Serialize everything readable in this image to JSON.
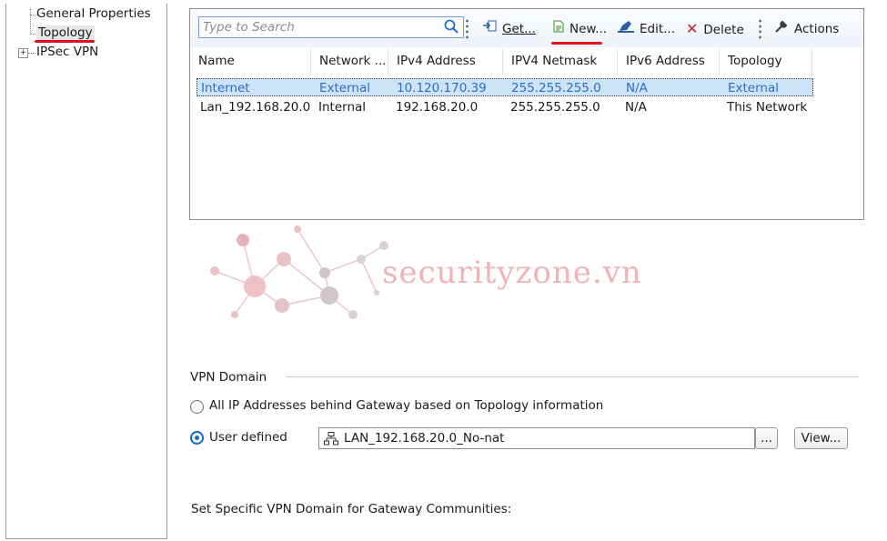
{
  "tree": {
    "items": [
      {
        "label": "General Properties"
      },
      {
        "label": "Topology"
      },
      {
        "label": "IPSec VPN"
      }
    ]
  },
  "toolbar": {
    "search_placeholder": "Type to Search",
    "get_label": "Get...",
    "new_label": "New...",
    "edit_label": "Edit...",
    "delete_label": "Delete",
    "actions_label": "Actions"
  },
  "table": {
    "columns": [
      "Name",
      "Network ...",
      "IPv4 Address",
      "IPV4 Netmask",
      "IPv6 Address",
      "Topology"
    ],
    "rows": [
      [
        "Internet",
        "External",
        "10.120.170.39",
        "255.255.255.0",
        "N/A",
        "External"
      ],
      [
        "Lan_192.168.20.0",
        "Internal",
        "192.168.20.0",
        "255.255.255.0",
        "N/A",
        "This Network"
      ]
    ]
  },
  "watermark": {
    "text": "securityzone.vn"
  },
  "vpn_domain": {
    "group_title": "VPN Domain",
    "option_all": "All IP Addresses behind Gateway based on Topology information",
    "option_user": "User defined",
    "selected": "User defined",
    "domain_value": "LAN_192.168.20.0_No-nat",
    "browse_label": "...",
    "view_label": "View...",
    "communities_label": "Set Specific VPN Domain for Gateway Communities:"
  },
  "colors": {
    "accent": "#1567c6",
    "selection_bg": "#cde3f7",
    "selection_text": "#2e6cc9",
    "annotation_red": "#e0101c",
    "watermark": "#f1b3b8"
  }
}
